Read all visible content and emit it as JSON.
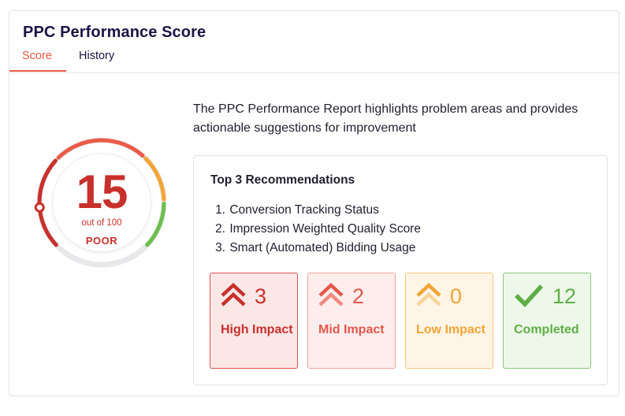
{
  "card": {
    "title": "PPC Performance Score"
  },
  "tabs": [
    {
      "label": "Score",
      "active": true
    },
    {
      "label": "History",
      "active": false
    }
  ],
  "gauge": {
    "score": "15",
    "out_of": "out of 100",
    "rating": "POOR",
    "score_fraction": 0.15,
    "colors": {
      "poor": "#c8302c",
      "fair": "#ea5a47",
      "good": "#f2a435",
      "excellent": "#6cbf4f",
      "track": "#e6e6e6"
    }
  },
  "description": "The PPC Performance Report highlights problem areas and provides actionable suggestions for improvement",
  "recommendations": {
    "title": "Top 3 Recommendations",
    "items": [
      {
        "num": "1.",
        "label": "Conversion Tracking Status"
      },
      {
        "num": "2.",
        "label": "Impression Weighted Quality Score"
      },
      {
        "num": "3.",
        "label": "Smart (Automated) Bidding Usage"
      }
    ]
  },
  "impacts": {
    "high": {
      "count": "3",
      "label": "High Impact",
      "icon": "double-chevron-up-icon",
      "color": "#c8302c"
    },
    "mid": {
      "count": "2",
      "label": "Mid Impact",
      "icon": "double-chevron-up-icon",
      "color": "#e4574c"
    },
    "low": {
      "count": "0",
      "label": "Low Impact",
      "icon": "double-chevron-up-icon",
      "color": "#f2a435"
    },
    "completed": {
      "count": "12",
      "label": "Completed",
      "icon": "checkmark-icon",
      "color": "#5fae47"
    }
  }
}
